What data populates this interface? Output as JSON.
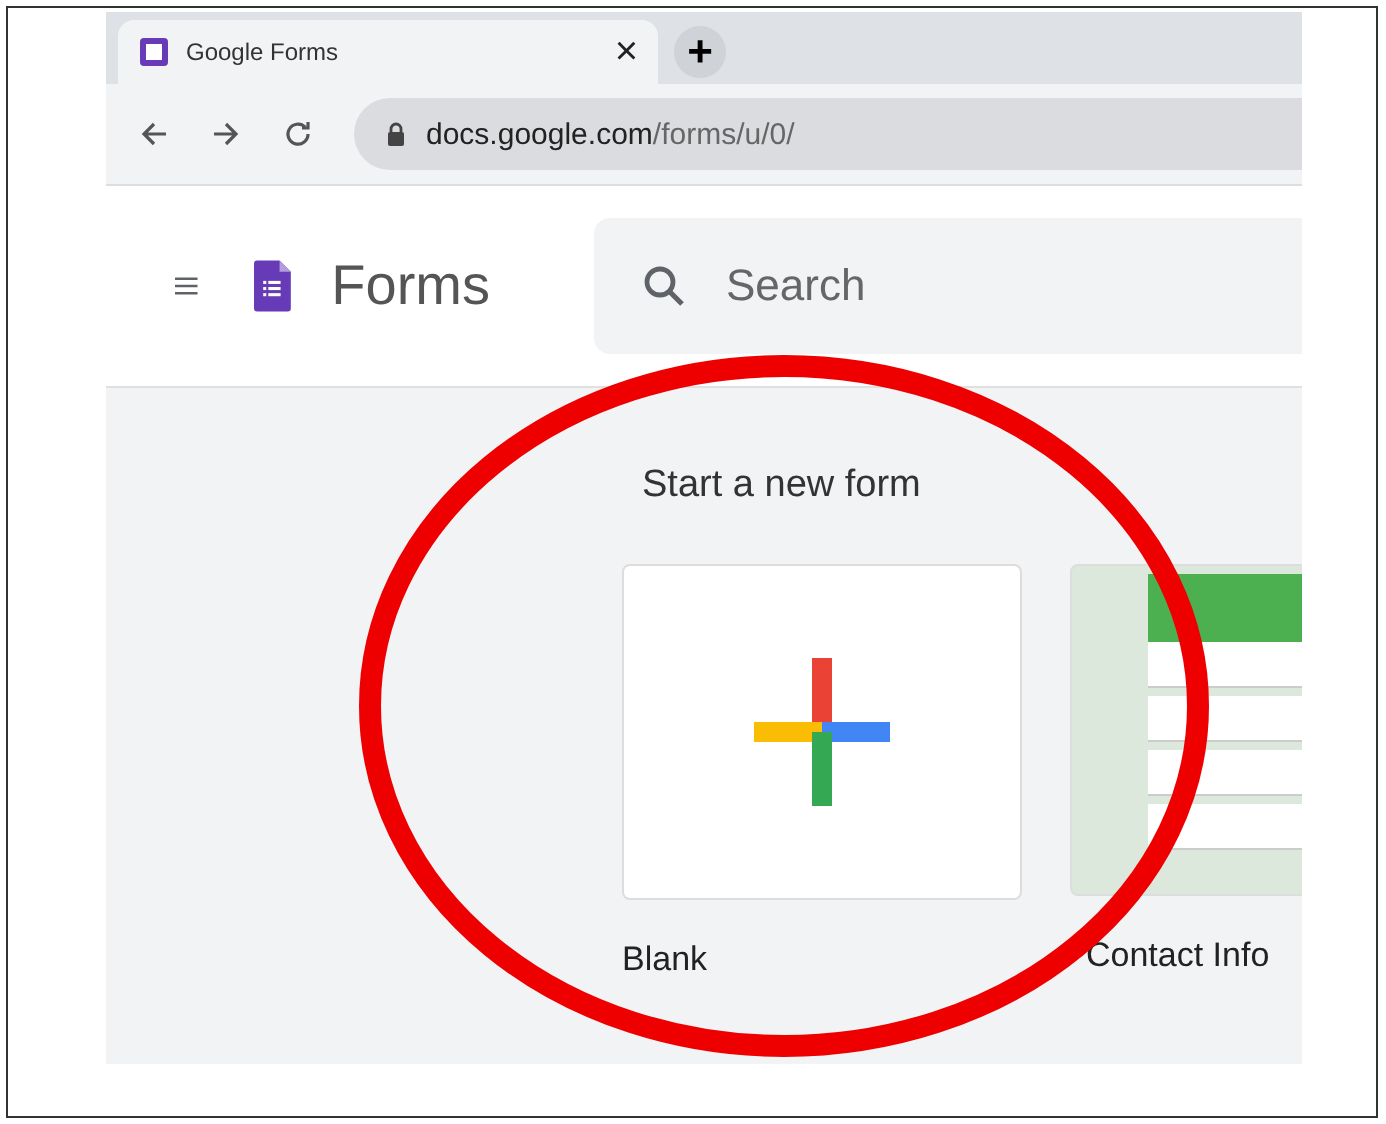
{
  "browser": {
    "tab_title": "Google Forms",
    "close_glyph": "×",
    "new_tab_glyph": "+",
    "url_domain": "docs.google.com",
    "url_path": "/forms/u/0/"
  },
  "app": {
    "name": "Forms",
    "search": {
      "placeholder": "Search"
    }
  },
  "section_title": "Start a new form",
  "templates": [
    {
      "kind": "blank",
      "label": "Blank"
    },
    {
      "kind": "contact",
      "label": "Contact Info"
    }
  ],
  "annotation": {
    "kind": "ellipse",
    "color": "#ee0000"
  }
}
